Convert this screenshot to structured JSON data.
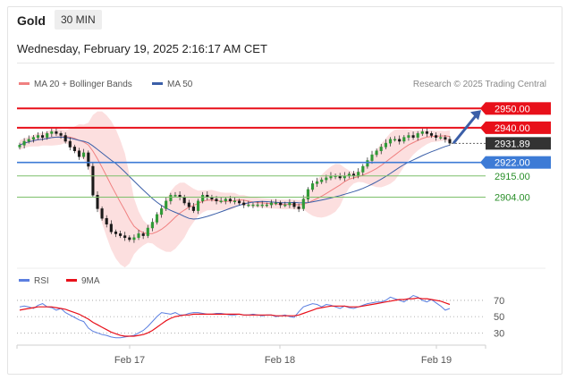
{
  "header": {
    "title": "Gold",
    "timeframe": "30 MIN",
    "datetime": "Wednesday, February 19, 2025 2:16:17 AM CET"
  },
  "legend": {
    "ma20": "MA 20 + Bollinger Bands",
    "ma50": "MA 50",
    "credit": "Research © 2025 Trading Central"
  },
  "colors": {
    "resistance": "#e8101a",
    "support": "#3d7bd6",
    "green_level": "#7cbf6a",
    "candle": "#2f9a36",
    "bollinger_fill": "#fbd4d4",
    "ma20": "#f08080",
    "ma50": "#3b5fa8",
    "rsi": "#5b7fe0",
    "rsi_ma": "#e8101a",
    "current_price_tag": "#333333"
  },
  "chart_data": [
    {
      "type": "candlestick",
      "x_tick_labels": [
        "Feb 17",
        "Feb 18",
        "Feb 19"
      ],
      "ylim": [
        2875,
        2952
      ],
      "horizontal_levels": [
        {
          "value": 2950.0,
          "label": "2950.00",
          "kind": "resistance"
        },
        {
          "value": 2940.0,
          "label": "2940.00",
          "kind": "resistance"
        },
        {
          "value": 2931.89,
          "label": "2931.89",
          "kind": "current"
        },
        {
          "value": 2922.0,
          "label": "2922.00",
          "kind": "pivot"
        },
        {
          "value": 2915.0,
          "label": "2915.00",
          "kind": "support"
        },
        {
          "value": 2904.0,
          "label": "2904.00",
          "kind": "support"
        }
      ],
      "close_series": [
        2931,
        2933,
        2934,
        2935,
        2936,
        2935,
        2937,
        2938,
        2937,
        2936,
        2933,
        2930,
        2928,
        2925,
        2927,
        2920,
        2905,
        2898,
        2893,
        2890,
        2886,
        2885,
        2884,
        2883,
        2882,
        2883,
        2885,
        2884,
        2888,
        2891,
        2895,
        2898,
        2902,
        2905,
        2905,
        2904,
        2901,
        2899,
        2897,
        2902,
        2905,
        2904,
        2903,
        2902,
        2902,
        2903,
        2902,
        2902,
        2901,
        2900,
        2900,
        2900,
        2900,
        2900,
        2900,
        2901,
        2901,
        2900,
        2900,
        2901,
        2899,
        2898,
        2903,
        2908,
        2911,
        2912,
        2913,
        2914,
        2915,
        2915,
        2914,
        2915,
        2916,
        2915,
        2917,
        2920,
        2923,
        2926,
        2928,
        2930,
        2932,
        2934,
        2934,
        2933,
        2935,
        2936,
        2935,
        2937,
        2938,
        2937,
        2936,
        2935,
        2935,
        2934,
        2932
      ],
      "series": [
        {
          "name": "MA 20 + Bollinger Bands"
        },
        {
          "name": "MA 50"
        }
      ],
      "forecast_arrow": {
        "from": 2931.89,
        "to": 2950.0
      }
    },
    {
      "type": "line",
      "legend": [
        "RSI",
        "9MA"
      ],
      "y_ticks": [
        70,
        50,
        30
      ],
      "ylim": [
        15,
        82
      ],
      "rsi": [
        62,
        63,
        62,
        60,
        64,
        66,
        62,
        61,
        58,
        60,
        55,
        52,
        49,
        46,
        44,
        36,
        32,
        30,
        28,
        27,
        25,
        24,
        24,
        25,
        26,
        27,
        30,
        33,
        38,
        44,
        50,
        55,
        54,
        53,
        55,
        52,
        52,
        54,
        55,
        55,
        54,
        53,
        53,
        54,
        54,
        53,
        52,
        52,
        53,
        52,
        52,
        53,
        52,
        51,
        52,
        52,
        50,
        51,
        52,
        50,
        49,
        56,
        62,
        64,
        66,
        65,
        62,
        65,
        64,
        62,
        60,
        63,
        61,
        60,
        62,
        64,
        66,
        67,
        68,
        68,
        70,
        74,
        72,
        70,
        68,
        72,
        76,
        74,
        70,
        68,
        71,
        67,
        63,
        58,
        60
      ],
      "rsi_9ma": [
        58,
        59,
        60,
        61,
        62,
        62,
        62,
        62,
        61,
        60,
        59,
        57,
        55,
        53,
        50,
        47,
        43,
        40,
        37,
        34,
        31,
        29,
        27,
        26,
        26,
        26,
        27,
        28,
        30,
        33,
        37,
        41,
        45,
        48,
        50,
        51,
        52,
        52,
        53,
        53,
        53,
        53,
        53,
        53,
        53,
        53,
        53,
        53,
        53,
        52,
        52,
        52,
        52,
        52,
        52,
        52,
        51,
        51,
        51,
        51,
        51,
        52,
        54,
        56,
        58,
        60,
        61,
        62,
        63,
        63,
        63,
        63,
        62,
        62,
        62,
        63,
        64,
        65,
        66,
        67,
        68,
        69,
        70,
        71,
        71,
        72,
        72,
        73,
        72,
        72,
        71,
        70,
        69,
        67,
        65
      ]
    }
  ]
}
